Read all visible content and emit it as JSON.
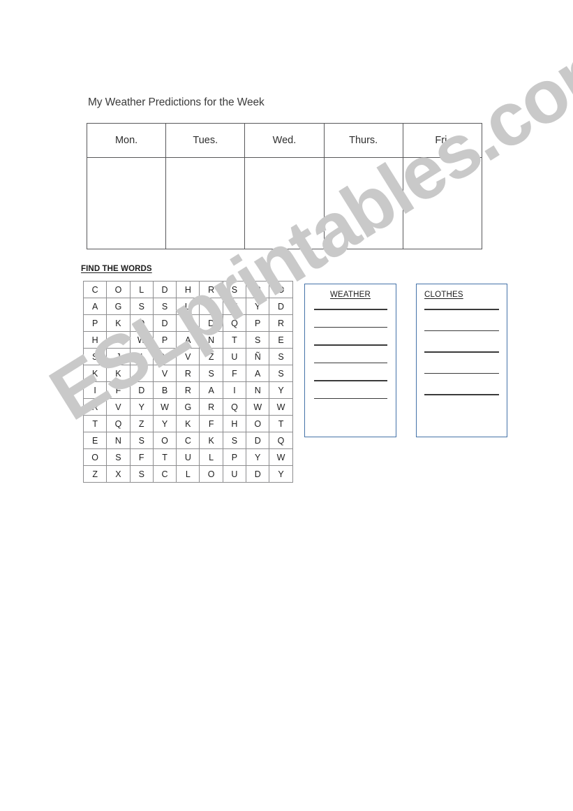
{
  "worksheet": {
    "title": "My Weather Predictions for the Week",
    "find_heading": "FIND THE WORDS"
  },
  "week_table": {
    "headers": [
      "Mon.",
      "Tues.",
      "Wed.",
      "Thurs.",
      "Fri."
    ],
    "body_row": [
      "",
      "",
      "",
      "",
      ""
    ]
  },
  "wordsearch": {
    "rows": 12,
    "cols": 9,
    "grid": [
      [
        "C",
        "O",
        "L",
        "D",
        "H",
        "R",
        "S",
        "R",
        "O"
      ],
      [
        "A",
        "G",
        "S",
        "S",
        "U",
        "N",
        "N",
        "Y",
        "D"
      ],
      [
        "P",
        "K",
        "D",
        "D",
        "S",
        "D",
        "Q",
        "P",
        "R"
      ],
      [
        "H",
        "H",
        "W",
        "P",
        "A",
        "N",
        "T",
        "S",
        "E"
      ],
      [
        "S",
        "J",
        "I",
        "X",
        "V",
        "Z",
        "U",
        "Ñ",
        "S"
      ],
      [
        "K",
        "K",
        "N",
        "V",
        "R",
        "S",
        "F",
        "A",
        "S"
      ],
      [
        "I",
        "F",
        "D",
        "B",
        "R",
        "A",
        "I",
        "N",
        "Y"
      ],
      [
        "R",
        "V",
        "Y",
        "W",
        "G",
        "R",
        "Q",
        "W",
        "W"
      ],
      [
        "T",
        "Q",
        "Z",
        "Y",
        "K",
        "F",
        "H",
        "O",
        "T"
      ],
      [
        "E",
        "N",
        "S",
        "O",
        "C",
        "K",
        "S",
        "D",
        "Q"
      ],
      [
        "O",
        "S",
        "F",
        "T",
        "U",
        "L",
        "P",
        "Y",
        "W"
      ],
      [
        "Z",
        "X",
        "S",
        "C",
        "L",
        "O",
        "U",
        "D",
        "Y"
      ]
    ]
  },
  "answer_boxes": [
    {
      "id": "weather",
      "title": "WEATHER",
      "line_count": 6,
      "border_color": "#4472a8"
    },
    {
      "id": "clothes",
      "title": "CLOTHES",
      "line_count": 5,
      "border_color": "#4472a8"
    }
  ],
  "watermark": {
    "text": "ESLprintables.com",
    "color": "#c9c9c9"
  }
}
